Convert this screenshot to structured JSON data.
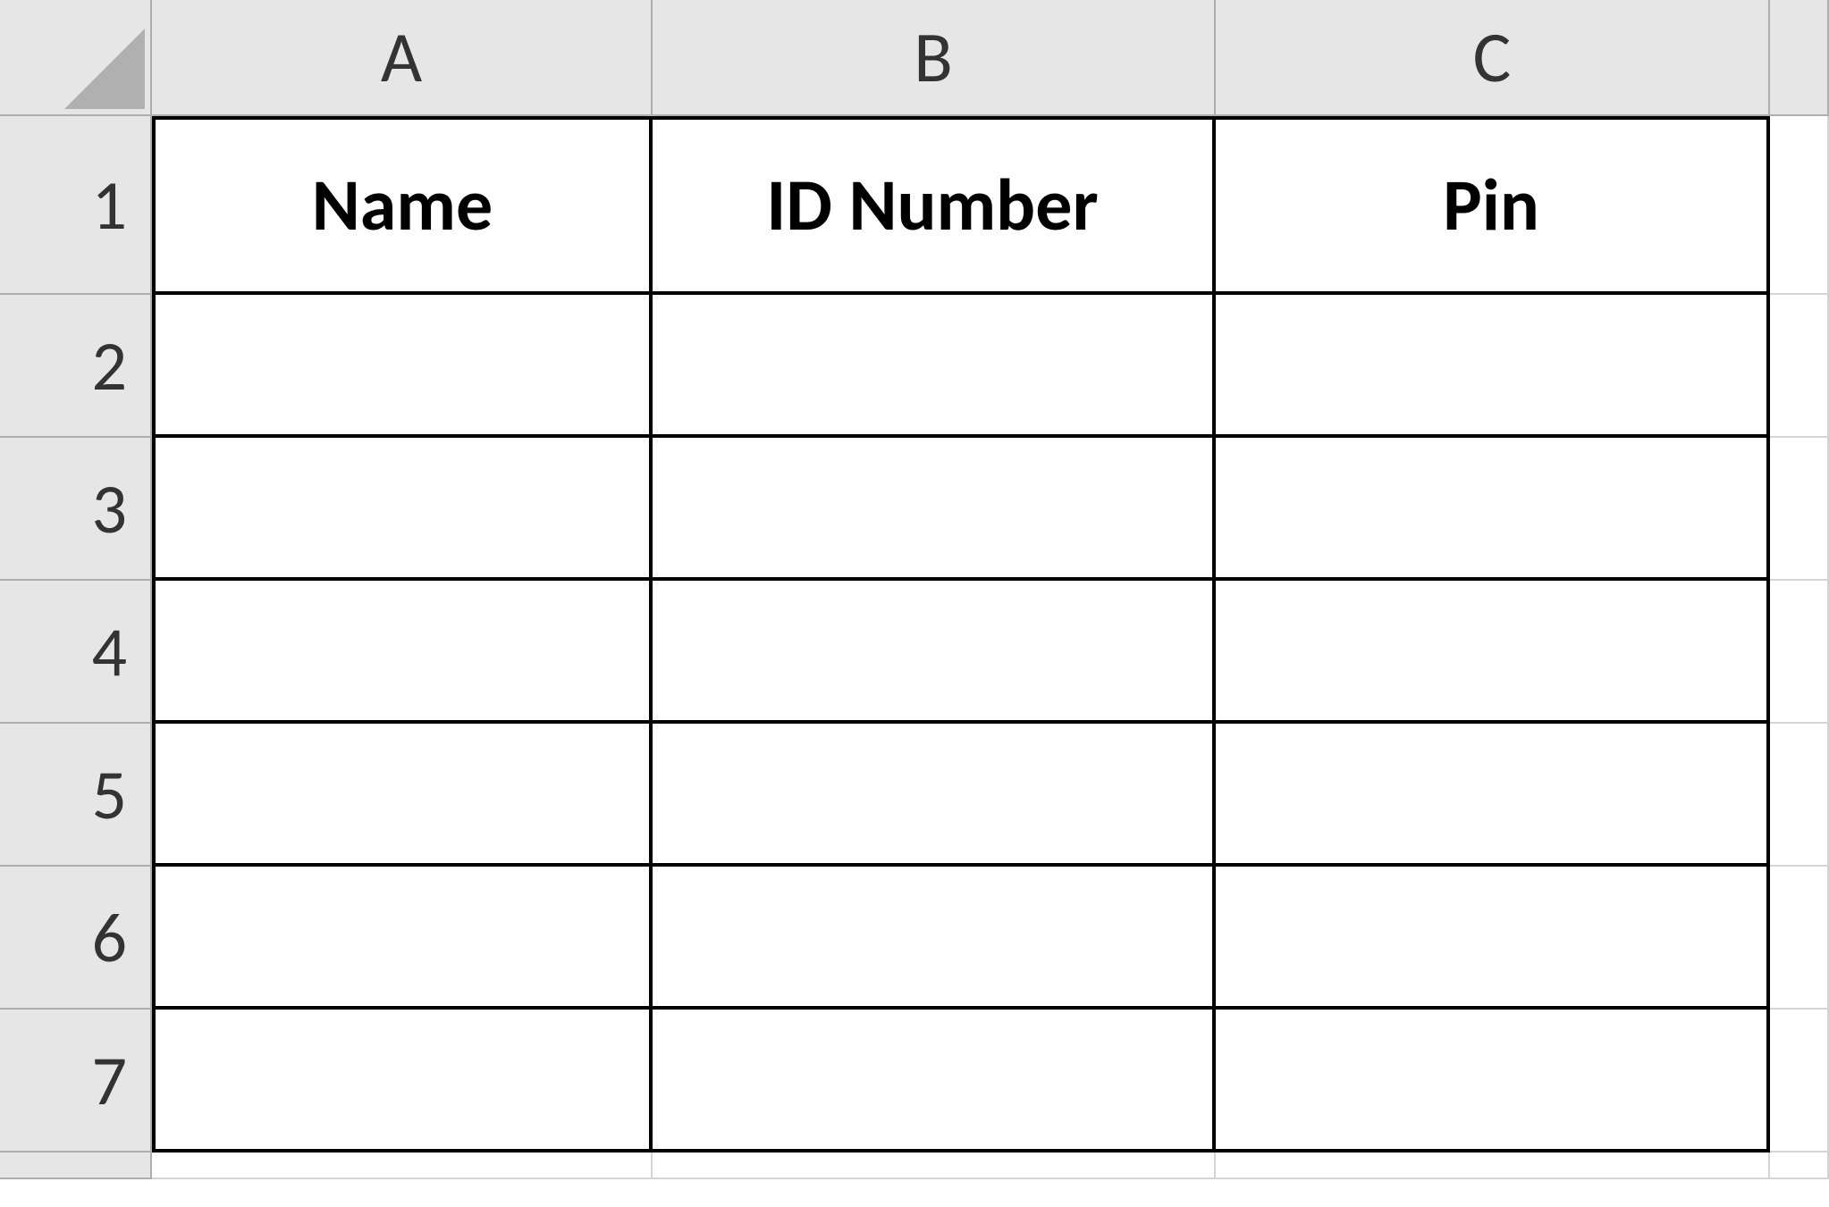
{
  "columns": [
    "A",
    "B",
    "C"
  ],
  "rows": [
    "1",
    "2",
    "3",
    "4",
    "5",
    "6",
    "7"
  ],
  "table": {
    "headers": {
      "A": "Name",
      "B": "ID Number",
      "C": "Pin"
    },
    "data": [
      {
        "A": "",
        "B": "",
        "C": ""
      },
      {
        "A": "",
        "B": "",
        "C": ""
      },
      {
        "A": "",
        "B": "",
        "C": ""
      },
      {
        "A": "",
        "B": "",
        "C": ""
      },
      {
        "A": "",
        "B": "",
        "C": ""
      },
      {
        "A": "",
        "B": "",
        "C": ""
      }
    ]
  }
}
